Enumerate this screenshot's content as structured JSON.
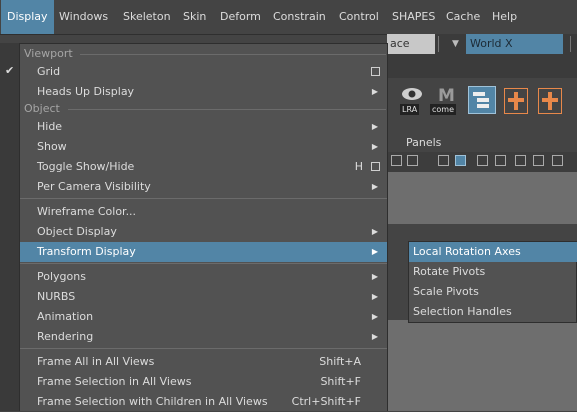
{
  "menubar": {
    "items": [
      "Display",
      "Windows",
      "Skeleton",
      "Skin",
      "Deform",
      "Constrain",
      "Control",
      "SHAPES",
      "Cache",
      "Help"
    ]
  },
  "toolbar": {
    "space_field": "ace",
    "world_dropdown": "World X"
  },
  "shelf": {
    "lra_label": "LRA",
    "come_label": "come"
  },
  "panel": {
    "panels_label": "Panels"
  },
  "display_menu": {
    "section_viewport": "Viewport",
    "section_object": "Object",
    "grid": "Grid",
    "heads_up_display": "Heads Up Display",
    "hide": "Hide",
    "show": "Show",
    "toggle_show_hide": "Toggle Show/Hide",
    "toggle_show_hide_shortcut": "H",
    "per_camera_visibility": "Per Camera Visibility",
    "wireframe_color": "Wireframe Color...",
    "object_display": "Object Display",
    "transform_display": "Transform Display",
    "polygons": "Polygons",
    "nurbs": "NURBS",
    "animation": "Animation",
    "rendering": "Rendering",
    "frame_all": "Frame All in All Views",
    "frame_all_shortcut": "Shift+A",
    "frame_selection": "Frame Selection in All Views",
    "frame_selection_shortcut": "Shift+F",
    "frame_selection_children": "Frame Selection with Children in All Views",
    "frame_selection_children_shortcut": "Ctrl+Shift+F"
  },
  "transform_submenu": {
    "items": [
      "Local Rotation Axes",
      "Rotate Pivots",
      "Scale Pivots",
      "Selection Handles"
    ]
  },
  "colors": {
    "accent": "#5285a6",
    "menu_bg": "#525252",
    "app_bg": "#444444"
  }
}
